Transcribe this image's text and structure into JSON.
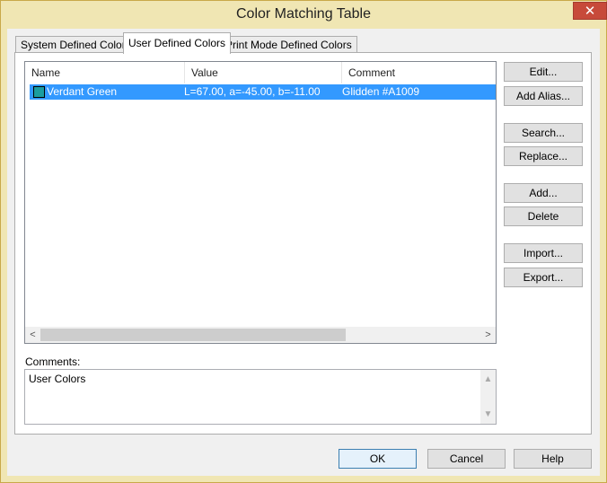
{
  "window": {
    "title": "Color Matching Table",
    "close_glyph": "✕"
  },
  "tabs": [
    {
      "label": "System Defined Colors",
      "active": false
    },
    {
      "label": "User Defined Colors",
      "active": true
    },
    {
      "label": "Print Mode Defined Colors",
      "active": false
    }
  ],
  "table": {
    "columns": [
      "Name",
      "Value",
      "Comment"
    ],
    "rows": [
      {
        "name": "Verdant Green",
        "value": "L=67.00, a=-45.00, b=-11.00",
        "comment": "Glidden #A1009",
        "swatch_color": "#1b9da0",
        "selected": true
      }
    ]
  },
  "scroll": {
    "left_glyph": "<",
    "right_glyph": ">",
    "up_glyph": "▲",
    "down_glyph": "▼"
  },
  "comments": {
    "label": "Comments:",
    "value": "User Colors"
  },
  "side_buttons": {
    "edit": "Edit...",
    "add_alias": "Add Alias...",
    "search": "Search...",
    "replace": "Replace...",
    "add": "Add...",
    "delete": "Delete",
    "import": "Import...",
    "export": "Export..."
  },
  "bottom_buttons": {
    "ok": "OK",
    "cancel": "Cancel",
    "help": "Help"
  },
  "colors": {
    "accent": "#3399ff",
    "titlebar": "#f0e6b3",
    "close": "#c74a3a"
  }
}
